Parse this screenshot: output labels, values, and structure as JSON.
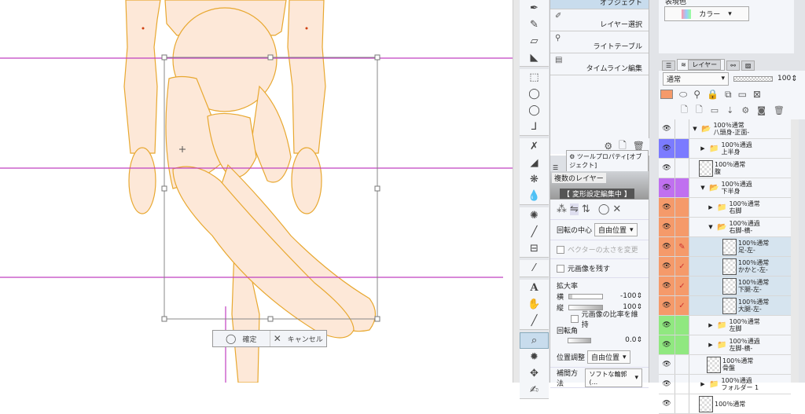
{
  "canvas": {
    "confirm_label": "確定",
    "cancel_label": "キャンセル",
    "guide_color": "#c040c0",
    "figure_fill": "#fde8d8",
    "figure_stroke": "#e8a830"
  },
  "tools": [
    "pen-icon",
    "pencil-icon",
    "eraser-icon",
    "fill-corner-icon",
    "rect-select-icon",
    "lasso-icon",
    "lasso2-icon",
    "select-pen-icon",
    "airbrush-icon",
    "gradient-brush-icon",
    "decoration-icon",
    "blend-icon",
    "sparkle-icon",
    "line-icon",
    "frame-icon",
    "ruler-icon",
    "text-icon",
    "hand-icon",
    "eyedropper-icon",
    "object-icon",
    "gear-select-icon",
    "move-icon",
    "correction-icon"
  ],
  "subtool": {
    "items": [
      {
        "label": "オブジェクト"
      },
      {
        "label": "レイヤー選択"
      },
      {
        "label": "ライトテーブル"
      },
      {
        "label": "タイムライン編集"
      }
    ]
  },
  "props": {
    "tab": "ツールプロパティ[オブジェクト]",
    "layer_header": "複数のレイヤー",
    "editing": "【 変形設定編集中 】",
    "rotation_center_label": "回転の中心",
    "rotation_center": "自由位置",
    "vector_width_label": "ベクターの太さを変更",
    "keep_original_label": "元画像を残す",
    "scale_label": "拡大率",
    "horiz_label": "横",
    "horiz_value": "-100",
    "vert_label": "縦",
    "vert_value": "100",
    "keep_ratio_label": "元画像の比率を維持",
    "angle_label": "回転角",
    "angle_value": "0.0",
    "position_label": "位置調整",
    "position_value": "自由位置",
    "interp_label": "補間方法",
    "interp_value": "ソフトな輪郭(..."
  },
  "color_panel": {
    "label": "表現色",
    "value": "カラー"
  },
  "layer_panel": {
    "tab": "レイヤー",
    "blend": "通常",
    "opacity": "100",
    "color_swatch": "#f59a6a",
    "layers": [
      {
        "mode": "100％通常",
        "name": "八頭身-正面-",
        "type": "folder-open",
        "indent": 0,
        "color": ""
      },
      {
        "mode": "100％通過",
        "name": "上半身",
        "type": "folder",
        "indent": 1,
        "color": "#7b7bff"
      },
      {
        "mode": "100％通常",
        "name": "腹",
        "type": "layer",
        "indent": 0,
        "color": ""
      },
      {
        "mode": "100％通過",
        "name": "下半身",
        "type": "folder-open",
        "indent": 1,
        "color": "#c070f0"
      },
      {
        "mode": "100％通常",
        "name": "右脚",
        "type": "folder",
        "indent": 2,
        "color": "#f59a6a"
      },
      {
        "mode": "100％通過",
        "name": "右脚-横-",
        "type": "folder-open",
        "indent": 2,
        "color": "#f59a6a"
      },
      {
        "mode": "100％通常",
        "name": "足-左-",
        "type": "layer",
        "indent": 3,
        "color": "#f59a6a",
        "mark": "✎",
        "sel": true
      },
      {
        "mode": "100％通常",
        "name": "かかと-左-",
        "type": "layer",
        "indent": 3,
        "color": "#f59a6a",
        "mark": "✓",
        "sel": true
      },
      {
        "mode": "100％通常",
        "name": "下腿-左-",
        "type": "layer",
        "indent": 3,
        "color": "#f59a6a",
        "mark": "✓",
        "sel": true
      },
      {
        "mode": "100％通常",
        "name": "大腿-左-",
        "type": "layer",
        "indent": 3,
        "color": "#f59a6a",
        "mark": "✓",
        "sel": true
      },
      {
        "mode": "100％通常",
        "name": "左脚",
        "type": "folder",
        "indent": 2,
        "color": "#90e880"
      },
      {
        "mode": "100％通過",
        "name": "左脚-横-",
        "type": "folder",
        "indent": 2,
        "color": "#90e880"
      },
      {
        "mode": "100％通常",
        "name": "骨盤",
        "type": "layer",
        "indent": 1,
        "color": ""
      },
      {
        "mode": "100％通過",
        "name": "フォルダー 1",
        "type": "folder",
        "indent": 1,
        "color": ""
      },
      {
        "mode": "100％通常",
        "name": "",
        "type": "layer",
        "indent": 0,
        "color": ""
      }
    ]
  }
}
